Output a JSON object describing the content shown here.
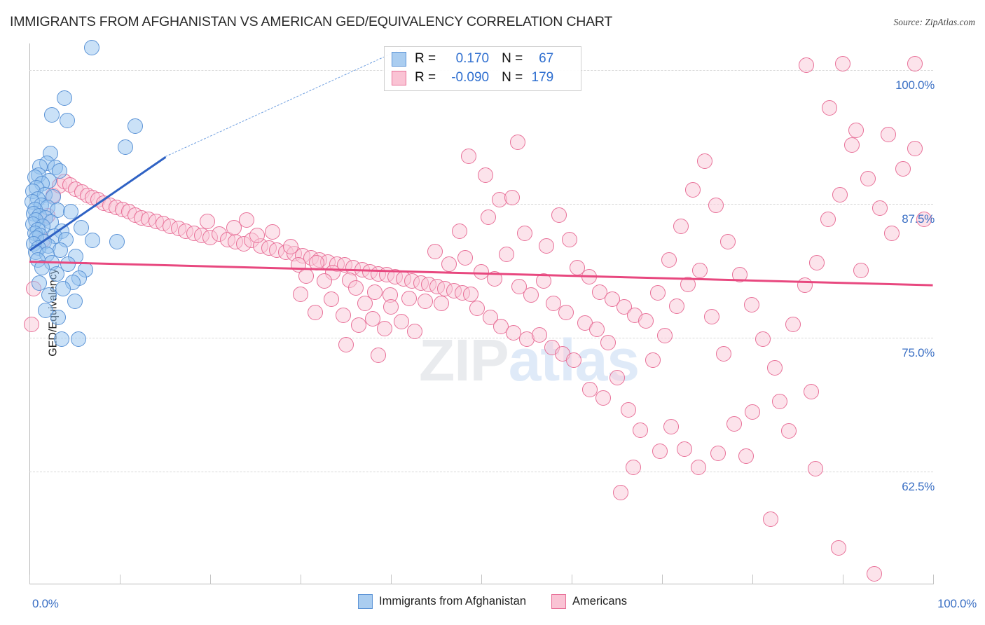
{
  "title": "IMMIGRANTS FROM AFGHANISTAN VS AMERICAN GED/EQUIVALENCY CORRELATION CHART",
  "source": "Source: ZipAtlas.com",
  "watermark": {
    "part1": "ZIP",
    "part2": "atlas"
  },
  "axes": {
    "ylabel": "GED/Equivalency",
    "ytick_labels": [
      "100.0%",
      "87.5%",
      "75.0%",
      "62.5%"
    ],
    "xmin_label": "0.0%",
    "xmax_label": "100.0%"
  },
  "stats_legend": {
    "rows": [
      {
        "series": "Immigrants from Afghanistan",
        "r_label": "R =",
        "r_value": "0.170",
        "n_label": "N =",
        "n_value": "67",
        "color": "#5b93d6"
      },
      {
        "series": "Americans",
        "r_label": "R =",
        "r_value": "-0.090",
        "n_label": "N =",
        "n_value": "179",
        "color": "#e87098"
      }
    ]
  },
  "bottom_legend": [
    {
      "label": "Immigrants from Afghanistan",
      "color": "#aacdf0"
    },
    {
      "label": "Americans",
      "color": "#fac3d4"
    }
  ],
  "chart_data": {
    "type": "scatter",
    "title": "IMMIGRANTS FROM AFGHANISTAN VS AMERICAN GED/EQUIVALENCY CORRELATION CHART",
    "xlabel": "",
    "ylabel": "GED/Equivalency",
    "xlim": [
      0,
      100
    ],
    "ylim": [
      52.0,
      102.5
    ],
    "xticks": [
      0,
      100
    ],
    "yticks": [
      62.5,
      75.0,
      87.5,
      100.0
    ],
    "grid": "horizontal-dashed",
    "legend_position": "bottom-center",
    "series": [
      {
        "name": "Immigrants from Afghanistan",
        "color": "#aacdf0",
        "edge_color": "#5b93d6",
        "R": 0.17,
        "N": 67,
        "trend": {
          "x0": 0.0,
          "y0": 83.3,
          "x1": 15.0,
          "y1": 92.0,
          "solid_to_x": 15.0,
          "dashed_to_x": 41.0,
          "dashed_to_y": 102.0
        },
        "points": [
          [
            6.9,
            102.1
          ],
          [
            3.9,
            97.4
          ],
          [
            2.5,
            95.8
          ],
          [
            4.2,
            95.3
          ],
          [
            11.7,
            94.8
          ],
          [
            10.6,
            92.8
          ],
          [
            2.3,
            92.2
          ],
          [
            1.9,
            91.3
          ],
          [
            1.2,
            91.0
          ],
          [
            2.9,
            90.9
          ],
          [
            3.3,
            90.6
          ],
          [
            1.0,
            90.2
          ],
          [
            0.6,
            90.0
          ],
          [
            2.2,
            89.7
          ],
          [
            1.4,
            89.4
          ],
          [
            0.8,
            89.0
          ],
          [
            0.4,
            88.7
          ],
          [
            1.7,
            88.4
          ],
          [
            2.6,
            88.2
          ],
          [
            0.9,
            88.0
          ],
          [
            0.3,
            87.7
          ],
          [
            1.3,
            87.4
          ],
          [
            2.0,
            87.2
          ],
          [
            0.6,
            87.0
          ],
          [
            3.1,
            86.9
          ],
          [
            4.6,
            86.8
          ],
          [
            0.5,
            86.6
          ],
          [
            1.1,
            86.4
          ],
          [
            1.8,
            86.2
          ],
          [
            0.7,
            86.0
          ],
          [
            2.4,
            85.8
          ],
          [
            0.4,
            85.6
          ],
          [
            1.5,
            85.4
          ],
          [
            5.7,
            85.3
          ],
          [
            0.9,
            85.1
          ],
          [
            3.6,
            85.0
          ],
          [
            0.6,
            84.8
          ],
          [
            1.2,
            84.6
          ],
          [
            2.8,
            84.5
          ],
          [
            0.8,
            84.3
          ],
          [
            4.0,
            84.2
          ],
          [
            1.6,
            84.0
          ],
          [
            0.5,
            83.8
          ],
          [
            2.1,
            83.6
          ],
          [
            7.0,
            84.1
          ],
          [
            9.7,
            84.0
          ],
          [
            1.0,
            83.4
          ],
          [
            3.4,
            83.2
          ],
          [
            0.7,
            83.0
          ],
          [
            1.9,
            82.8
          ],
          [
            5.1,
            82.6
          ],
          [
            0.9,
            82.3
          ],
          [
            2.5,
            82.0
          ],
          [
            4.3,
            81.9
          ],
          [
            1.4,
            81.6
          ],
          [
            6.2,
            81.4
          ],
          [
            3.0,
            81.0
          ],
          [
            5.5,
            80.6
          ],
          [
            4.8,
            80.2
          ],
          [
            3.7,
            79.6
          ],
          [
            2.2,
            79.0
          ],
          [
            5.0,
            78.4
          ],
          [
            1.8,
            77.6
          ],
          [
            3.2,
            76.9
          ],
          [
            3.6,
            74.9
          ],
          [
            5.4,
            74.9
          ],
          [
            1.1,
            80.1
          ]
        ]
      },
      {
        "name": "Americans",
        "color": "#fac3d4",
        "edge_color": "#e87098",
        "R": -0.09,
        "N": 179,
        "trend": {
          "x0": 0.0,
          "y0": 82.2,
          "x1": 100.0,
          "y1": 80.0
        },
        "points": [
          [
            0.2,
            76.3
          ],
          [
            0.5,
            79.6
          ],
          [
            1.5,
            84.1
          ],
          [
            2.0,
            86.4
          ],
          [
            2.6,
            88.3
          ],
          [
            3.3,
            89.2
          ],
          [
            3.9,
            89.6
          ],
          [
            4.5,
            89.3
          ],
          [
            5.1,
            88.9
          ],
          [
            5.8,
            88.6
          ],
          [
            6.4,
            88.3
          ],
          [
            7.0,
            88.1
          ],
          [
            7.6,
            87.9
          ],
          [
            8.2,
            87.6
          ],
          [
            8.9,
            87.4
          ],
          [
            9.6,
            87.2
          ],
          [
            10.3,
            87.0
          ],
          [
            11.0,
            86.8
          ],
          [
            11.7,
            86.5
          ],
          [
            12.4,
            86.2
          ],
          [
            13.2,
            86.1
          ],
          [
            14.0,
            85.9
          ],
          [
            14.8,
            85.7
          ],
          [
            15.6,
            85.4
          ],
          [
            16.5,
            85.2
          ],
          [
            17.3,
            85.0
          ],
          [
            18.2,
            84.8
          ],
          [
            19.1,
            84.6
          ],
          [
            20.0,
            84.4
          ],
          [
            21.0,
            84.7
          ],
          [
            21.9,
            84.2
          ],
          [
            22.8,
            84.0
          ],
          [
            23.7,
            83.8
          ],
          [
            24.6,
            84.1
          ],
          [
            25.6,
            83.6
          ],
          [
            26.5,
            83.4
          ],
          [
            27.4,
            83.2
          ],
          [
            28.4,
            83.0
          ],
          [
            29.3,
            82.9
          ],
          [
            30.2,
            82.7
          ],
          [
            31.2,
            82.5
          ],
          [
            32.1,
            82.3
          ],
          [
            33.0,
            82.1
          ],
          [
            34.0,
            81.9
          ],
          [
            34.9,
            81.8
          ],
          [
            35.8,
            81.6
          ],
          [
            36.8,
            81.4
          ],
          [
            37.7,
            81.2
          ],
          [
            38.6,
            81.0
          ],
          [
            39.5,
            80.9
          ],
          [
            40.5,
            80.7
          ],
          [
            41.4,
            80.5
          ],
          [
            42.3,
            80.3
          ],
          [
            43.3,
            80.1
          ],
          [
            44.2,
            80.0
          ],
          [
            45.1,
            79.8
          ],
          [
            46.0,
            79.6
          ],
          [
            47.0,
            79.4
          ],
          [
            47.9,
            79.2
          ],
          [
            48.8,
            79.1
          ],
          [
            24.0,
            86.0
          ],
          [
            26.9,
            84.9
          ],
          [
            28.9,
            83.5
          ],
          [
            31.8,
            82.0
          ],
          [
            33.6,
            81.1
          ],
          [
            35.4,
            80.4
          ],
          [
            19.7,
            85.9
          ],
          [
            22.6,
            85.3
          ],
          [
            25.2,
            84.6
          ],
          [
            29.8,
            81.8
          ],
          [
            30.6,
            80.8
          ],
          [
            32.6,
            80.3
          ],
          [
            36.1,
            79.7
          ],
          [
            38.2,
            79.3
          ],
          [
            39.9,
            79.0
          ],
          [
            42.0,
            78.7
          ],
          [
            43.8,
            78.4
          ],
          [
            45.6,
            78.2
          ],
          [
            30.0,
            79.1
          ],
          [
            33.4,
            78.6
          ],
          [
            37.1,
            78.2
          ],
          [
            40.0,
            77.9
          ],
          [
            31.6,
            77.4
          ],
          [
            34.7,
            77.1
          ],
          [
            38.0,
            76.8
          ],
          [
            41.2,
            76.5
          ],
          [
            36.4,
            76.2
          ],
          [
            39.3,
            75.9
          ],
          [
            42.6,
            75.6
          ],
          [
            35.0,
            74.4
          ],
          [
            38.6,
            73.4
          ],
          [
            46.4,
            81.9
          ],
          [
            48.2,
            82.5
          ],
          [
            50.0,
            81.2
          ],
          [
            51.5,
            80.5
          ],
          [
            52.8,
            82.8
          ],
          [
            54.2,
            79.8
          ],
          [
            55.5,
            79.0
          ],
          [
            56.9,
            80.3
          ],
          [
            58.0,
            78.2
          ],
          [
            59.4,
            77.4
          ],
          [
            60.6,
            81.6
          ],
          [
            61.9,
            80.7
          ],
          [
            63.1,
            79.3
          ],
          [
            64.5,
            78.6
          ],
          [
            65.8,
            77.9
          ],
          [
            67.0,
            77.1
          ],
          [
            49.5,
            77.8
          ],
          [
            51.0,
            76.9
          ],
          [
            52.2,
            76.1
          ],
          [
            53.6,
            75.5
          ],
          [
            55.0,
            74.9
          ],
          [
            56.4,
            75.3
          ],
          [
            57.8,
            74.1
          ],
          [
            59.0,
            73.5
          ],
          [
            60.2,
            72.9
          ],
          [
            61.5,
            76.4
          ],
          [
            62.8,
            75.8
          ],
          [
            64.0,
            74.6
          ],
          [
            50.8,
            86.3
          ],
          [
            52.0,
            87.9
          ],
          [
            53.4,
            88.1
          ],
          [
            54.8,
            84.8
          ],
          [
            47.6,
            85.0
          ],
          [
            44.9,
            83.1
          ],
          [
            57.2,
            83.6
          ],
          [
            58.6,
            86.5
          ],
          [
            59.8,
            84.2
          ],
          [
            48.6,
            92.0
          ],
          [
            54.0,
            93.3
          ],
          [
            50.5,
            90.2
          ],
          [
            62.0,
            70.2
          ],
          [
            63.5,
            69.4
          ],
          [
            65.0,
            71.3
          ],
          [
            66.3,
            68.3
          ],
          [
            67.6,
            66.4
          ],
          [
            69.0,
            72.9
          ],
          [
            70.3,
            75.2
          ],
          [
            71.6,
            78.0
          ],
          [
            72.9,
            80.0
          ],
          [
            74.2,
            81.3
          ],
          [
            75.5,
            77.0
          ],
          [
            76.8,
            73.5
          ],
          [
            68.2,
            76.6
          ],
          [
            69.5,
            79.2
          ],
          [
            70.8,
            82.3
          ],
          [
            72.1,
            85.4
          ],
          [
            73.4,
            88.8
          ],
          [
            74.7,
            91.5
          ],
          [
            76.0,
            87.4
          ],
          [
            77.3,
            84.0
          ],
          [
            78.6,
            80.9
          ],
          [
            79.9,
            78.1
          ],
          [
            81.2,
            74.9
          ],
          [
            82.5,
            72.2
          ],
          [
            65.4,
            60.6
          ],
          [
            72.5,
            64.6
          ],
          [
            76.2,
            64.2
          ],
          [
            80.0,
            68.1
          ],
          [
            83.0,
            69.1
          ],
          [
            82.0,
            58.1
          ],
          [
            84.5,
            76.3
          ],
          [
            85.8,
            79.9
          ],
          [
            87.1,
            82.0
          ],
          [
            88.4,
            86.1
          ],
          [
            89.7,
            88.4
          ],
          [
            91.0,
            93.0
          ],
          [
            86.0,
            100.5
          ],
          [
            90.0,
            100.6
          ],
          [
            98.0,
            100.6
          ],
          [
            88.5,
            96.5
          ],
          [
            91.5,
            94.4
          ],
          [
            95.0,
            94.0
          ],
          [
            92.8,
            89.9
          ],
          [
            94.1,
            87.1
          ],
          [
            95.4,
            84.8
          ],
          [
            96.7,
            90.8
          ],
          [
            98.0,
            92.7
          ],
          [
            99.0,
            86.1
          ],
          [
            86.5,
            70.0
          ],
          [
            84.0,
            66.3
          ],
          [
            87.0,
            62.8
          ],
          [
            89.5,
            55.4
          ],
          [
            93.5,
            53.0
          ],
          [
            92.0,
            81.3
          ],
          [
            78.0,
            67.0
          ],
          [
            79.3,
            64.0
          ],
          [
            74.0,
            62.9
          ],
          [
            66.8,
            62.9
          ],
          [
            69.8,
            64.4
          ],
          [
            71.0,
            66.7
          ]
        ]
      }
    ]
  }
}
